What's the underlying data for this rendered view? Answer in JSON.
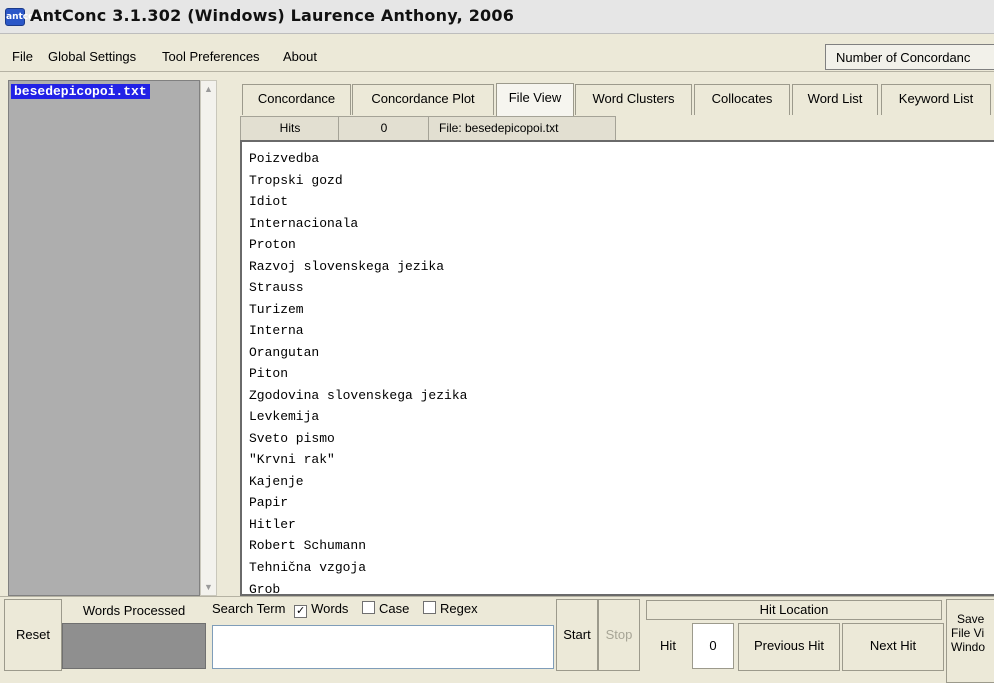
{
  "window": {
    "title": "AntConc 3.1.302 (Windows) Laurence Anthony, 2006",
    "icon_text": "antconc"
  },
  "menu": {
    "items": [
      "File",
      "Global Settings",
      "Tool Preferences",
      "About"
    ],
    "concordance_count_label": "Number of Concordanc"
  },
  "files": {
    "items": [
      "besedepicopoi.txt"
    ]
  },
  "tabs": [
    "Concordance",
    "Concordance Plot",
    "File View",
    "Word Clusters",
    "Collocates",
    "Word List",
    "Keyword List"
  ],
  "active_tab": "File View",
  "hits": {
    "label": "Hits",
    "value": "0",
    "file_label": "File: besedepicopoi.txt"
  },
  "text_lines": [
    "Poizvedba",
    "Tropski gozd",
    "Idiot",
    "Internacionala",
    "Proton",
    "Razvoj slovenskega jezika",
    "Strauss",
    "Turizem",
    "Interna",
    "Orangutan",
    "Piton",
    "Zgodovina slovenskega jezika",
    "Levkemija",
    "Sveto pismo",
    "\"Krvni rak\"",
    "Kajenje",
    "Papir",
    "Hitler",
    "Robert Schumann",
    "Tehnična vzgoja",
    "Grob"
  ],
  "bottom": {
    "reset": "Reset",
    "words_processed": "Words Processed",
    "search_term": "Search Term",
    "words_option": "Words",
    "case_option": "Case",
    "regex_option": "Regex",
    "words_checked": true,
    "case_checked": false,
    "regex_checked": false,
    "search_value": "",
    "start": "Start",
    "stop": "Stop",
    "hit_location": "Hit Location",
    "hit": "Hit",
    "hit_value": "0",
    "previous_hit": "Previous Hit",
    "next_hit": "Next Hit",
    "save_line1": "Save",
    "save_line2": "File Vi",
    "save_line3": "Windo"
  },
  "colors": {
    "selection": "#2222e6",
    "panel": "#ece9d8",
    "file_list_bg": "#aeaeae"
  }
}
